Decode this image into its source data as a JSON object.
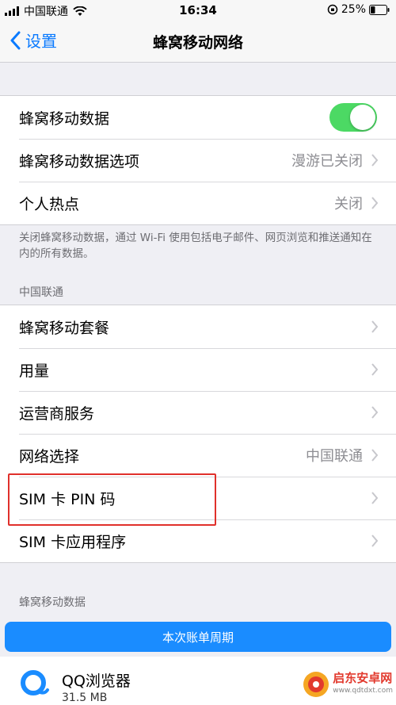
{
  "status_bar": {
    "carrier": "中国联通",
    "time": "16:34",
    "battery": "25%"
  },
  "nav": {
    "back_label": "设置",
    "title": "蜂窝移动网络"
  },
  "group1": {
    "cellular_data": {
      "label": "蜂窝移动数据",
      "enabled": true
    },
    "cellular_options": {
      "label": "蜂窝移动数据选项",
      "value": "漫游已关闭"
    },
    "hotspot": {
      "label": "个人热点",
      "value": "关闭"
    }
  },
  "group1_footer": "关闭蜂窝移动数据，通过 Wi-Fi 使用包括电子邮件、网页浏览和推送通知在内的所有数据。",
  "carrier_section": {
    "header": "中国联通",
    "items": [
      {
        "label": "蜂窝移动套餐",
        "value": ""
      },
      {
        "label": "用量",
        "value": ""
      },
      {
        "label": "运营商服务",
        "value": ""
      },
      {
        "label": "网络选择",
        "value": "中国联通"
      },
      {
        "label": "SIM 卡 PIN 码",
        "value": ""
      },
      {
        "label": "SIM 卡应用程序",
        "value": ""
      }
    ]
  },
  "usage_section": {
    "header": "蜂窝移动数据",
    "cycle_button": "本次账单周期",
    "app": {
      "name": "QQ浏览器",
      "size": "31.5 MB"
    }
  },
  "watermark": {
    "brand": "启东安卓网",
    "url": "www.qdtdxt.com"
  },
  "colors": {
    "accent": "#0a7aff",
    "toggle_on": "#4cd964",
    "highlight": "#e0302b",
    "button": "#1a8cff"
  }
}
